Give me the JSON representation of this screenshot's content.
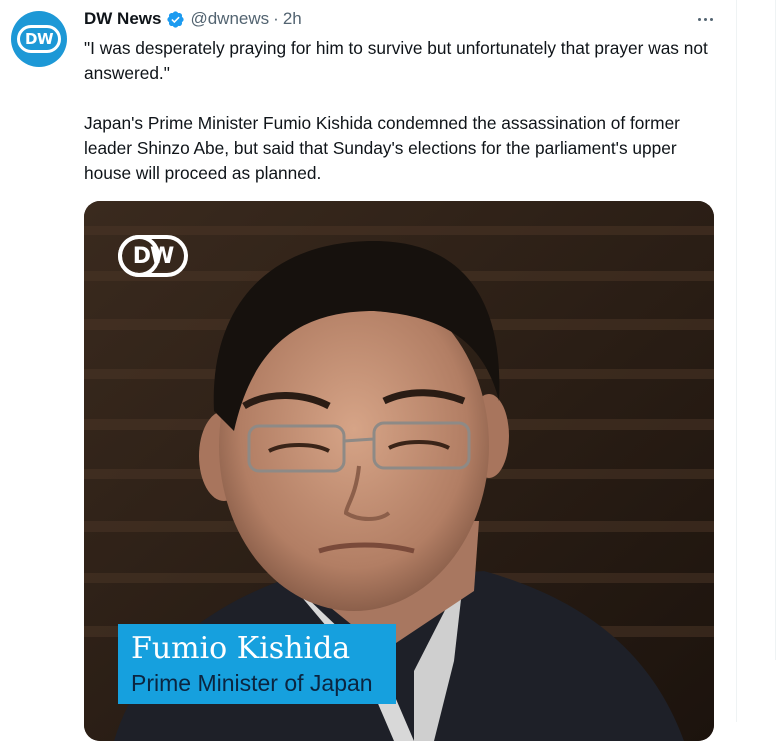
{
  "tweet": {
    "author_name": "DW News",
    "handle": "@dwnews",
    "separator": "·",
    "timestamp": "2h",
    "avatar_logo": "DW",
    "text_paragraphs": [
      "\"I was desperately praying for him to survive but unfortunately that prayer was not answered.\"",
      "Japan's Prime Minister Fumio Kishida condemned the assassination of former leader Shinzo Abe, but said that Sunday's elections for the parliament's upper house will proceed as planned."
    ]
  },
  "media": {
    "watermark_logo": "DW",
    "caption_name": "Fumio Kishida",
    "caption_title": "Prime Minister of Japan"
  },
  "icons": {
    "verified": "verified-badge-icon",
    "more": "more-options-icon"
  },
  "colors": {
    "brand_blue": "#1d98d6",
    "verified_blue": "#1d9bf0",
    "text_primary": "#0f1419",
    "text_secondary": "#536471",
    "caption_blue": "#16a0de"
  }
}
